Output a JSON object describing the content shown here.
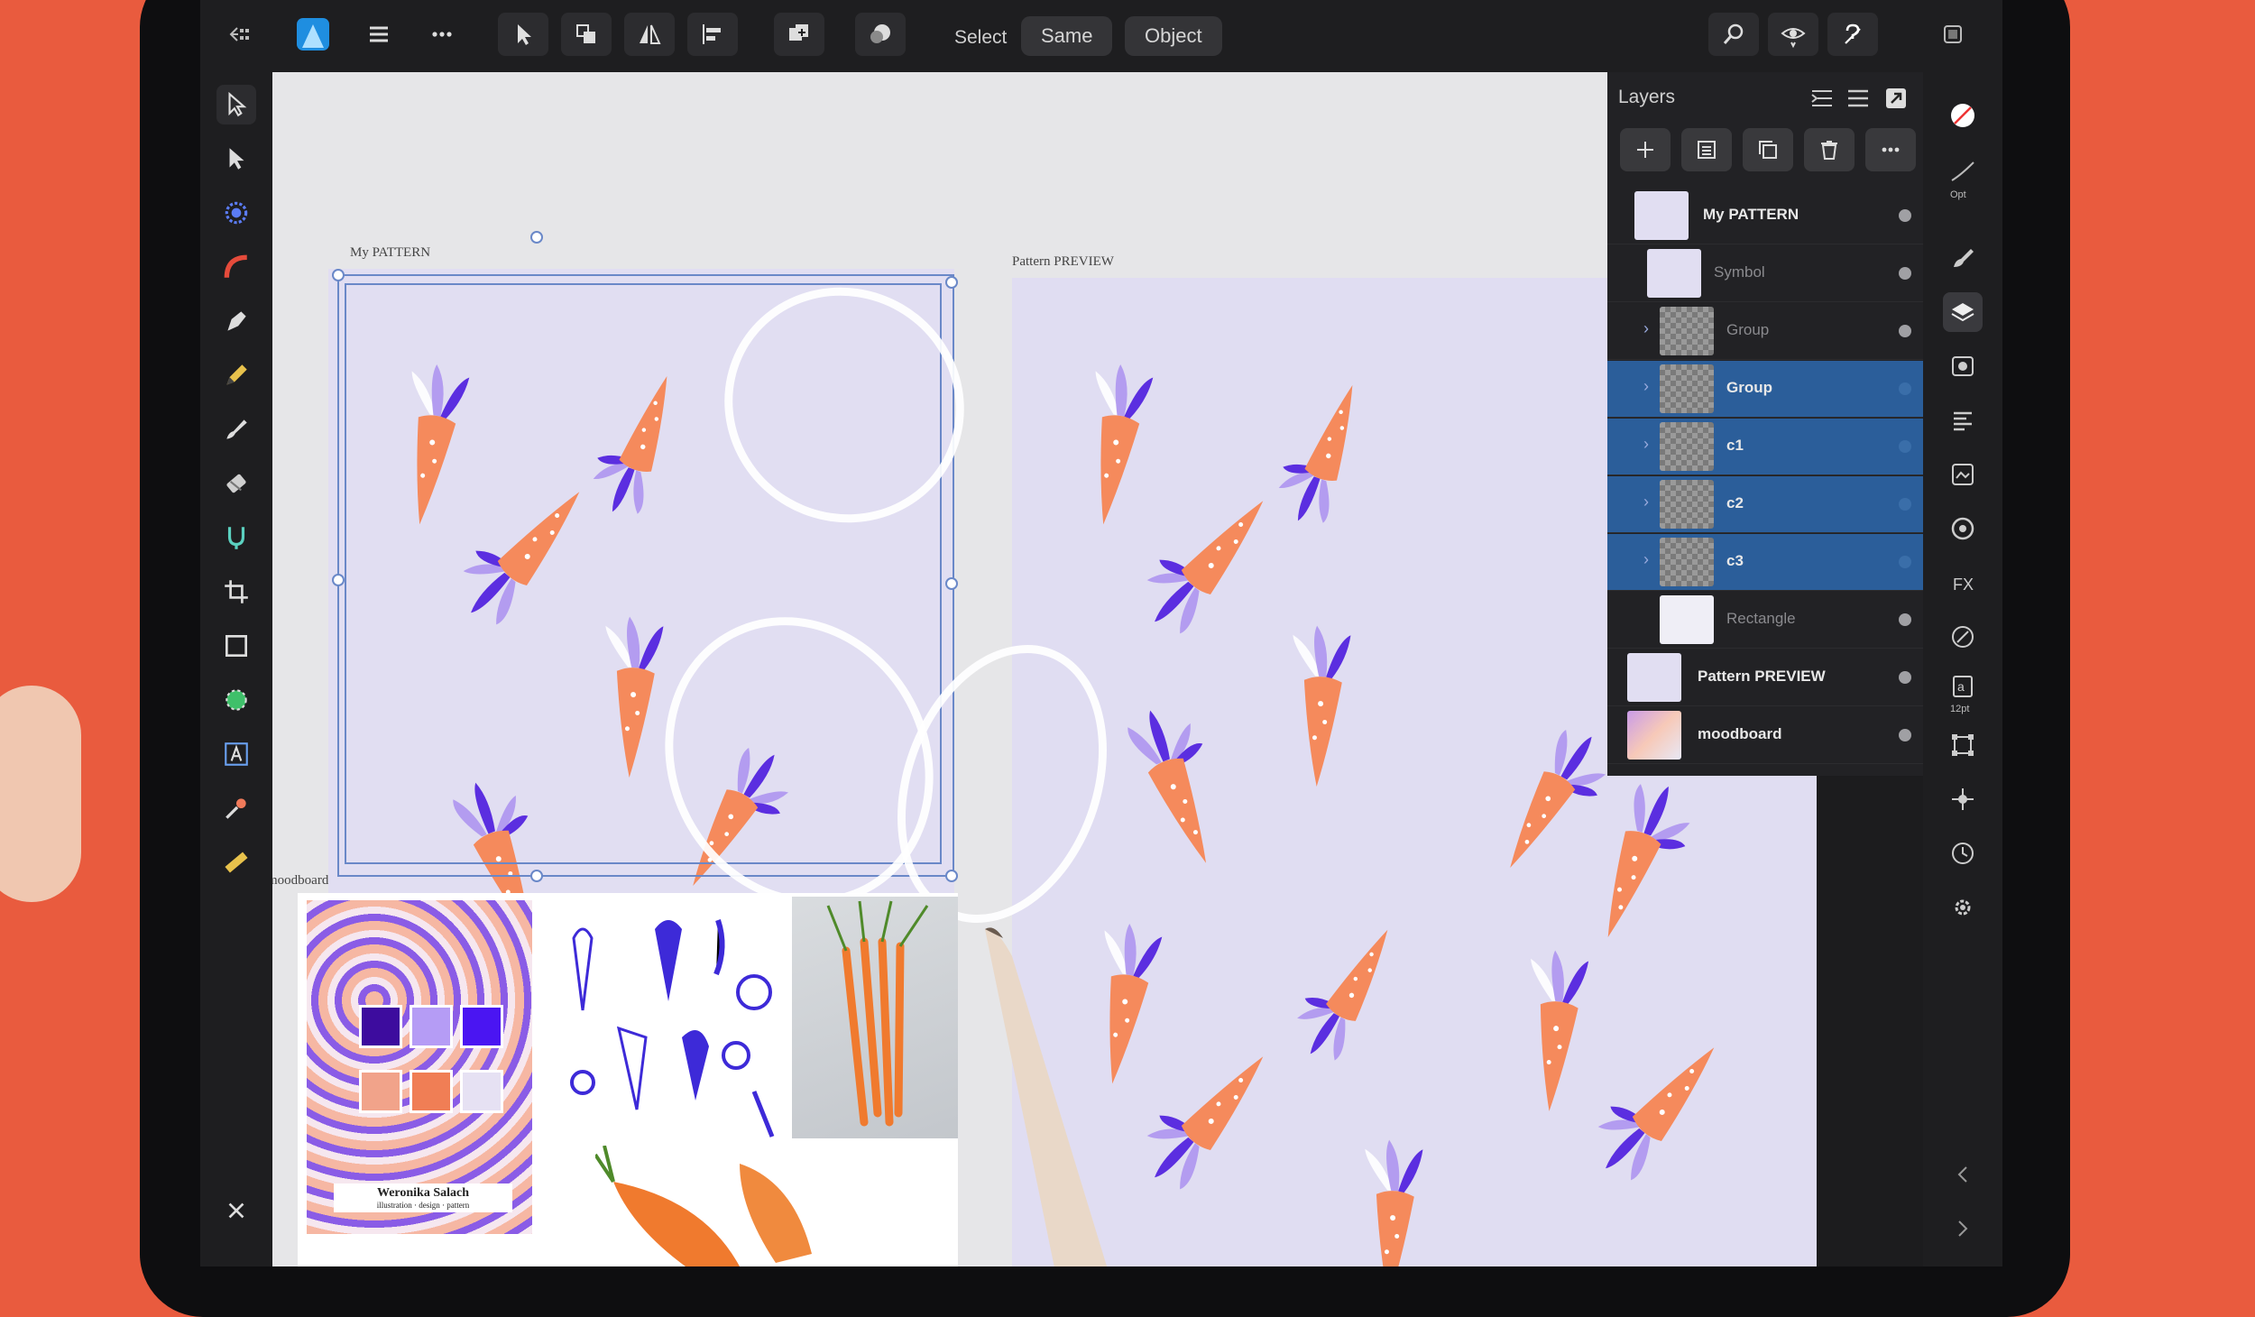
{
  "toolbar": {
    "select_label": "Select",
    "same_label": "Same",
    "object_label": "Object"
  },
  "canvas": {
    "artboard_pattern_label": "My PATTERN",
    "artboard_preview_label": "Pattern PREVIEW",
    "artboard_moodboard_label": "moodboard",
    "moodboard_caption": "Weronika Salach",
    "moodboard_subcaption": "illustration · design · pattern"
  },
  "layers_panel": {
    "title": "Layers",
    "layers": [
      {
        "name": "My PATTERN",
        "selected": false,
        "dimmed": false
      },
      {
        "name": "Symbol",
        "selected": false,
        "dimmed": true
      },
      {
        "name": "Group",
        "selected": false,
        "dimmed": true
      },
      {
        "name": "Group",
        "selected": true,
        "dimmed": false
      },
      {
        "name": "c1",
        "selected": true,
        "dimmed": false
      },
      {
        "name": "c2",
        "selected": true,
        "dimmed": false
      },
      {
        "name": "c3",
        "selected": true,
        "dimmed": false
      },
      {
        "name": "Rectangle",
        "selected": false,
        "dimmed": true
      },
      {
        "name": "Pattern PREVIEW",
        "selected": false,
        "dimmed": false
      },
      {
        "name": "moodboard",
        "selected": false,
        "dimmed": false
      }
    ]
  },
  "studio": {
    "opt_label": "Opt",
    "font_size_label": "12pt"
  },
  "colors": {
    "background": "#e95b3e",
    "selection": "#2b5e9a",
    "carrot_orange": "#f58a5c",
    "leaf_purple": "#5b2ee0",
    "leaf_lilac": "#b39cf0"
  }
}
